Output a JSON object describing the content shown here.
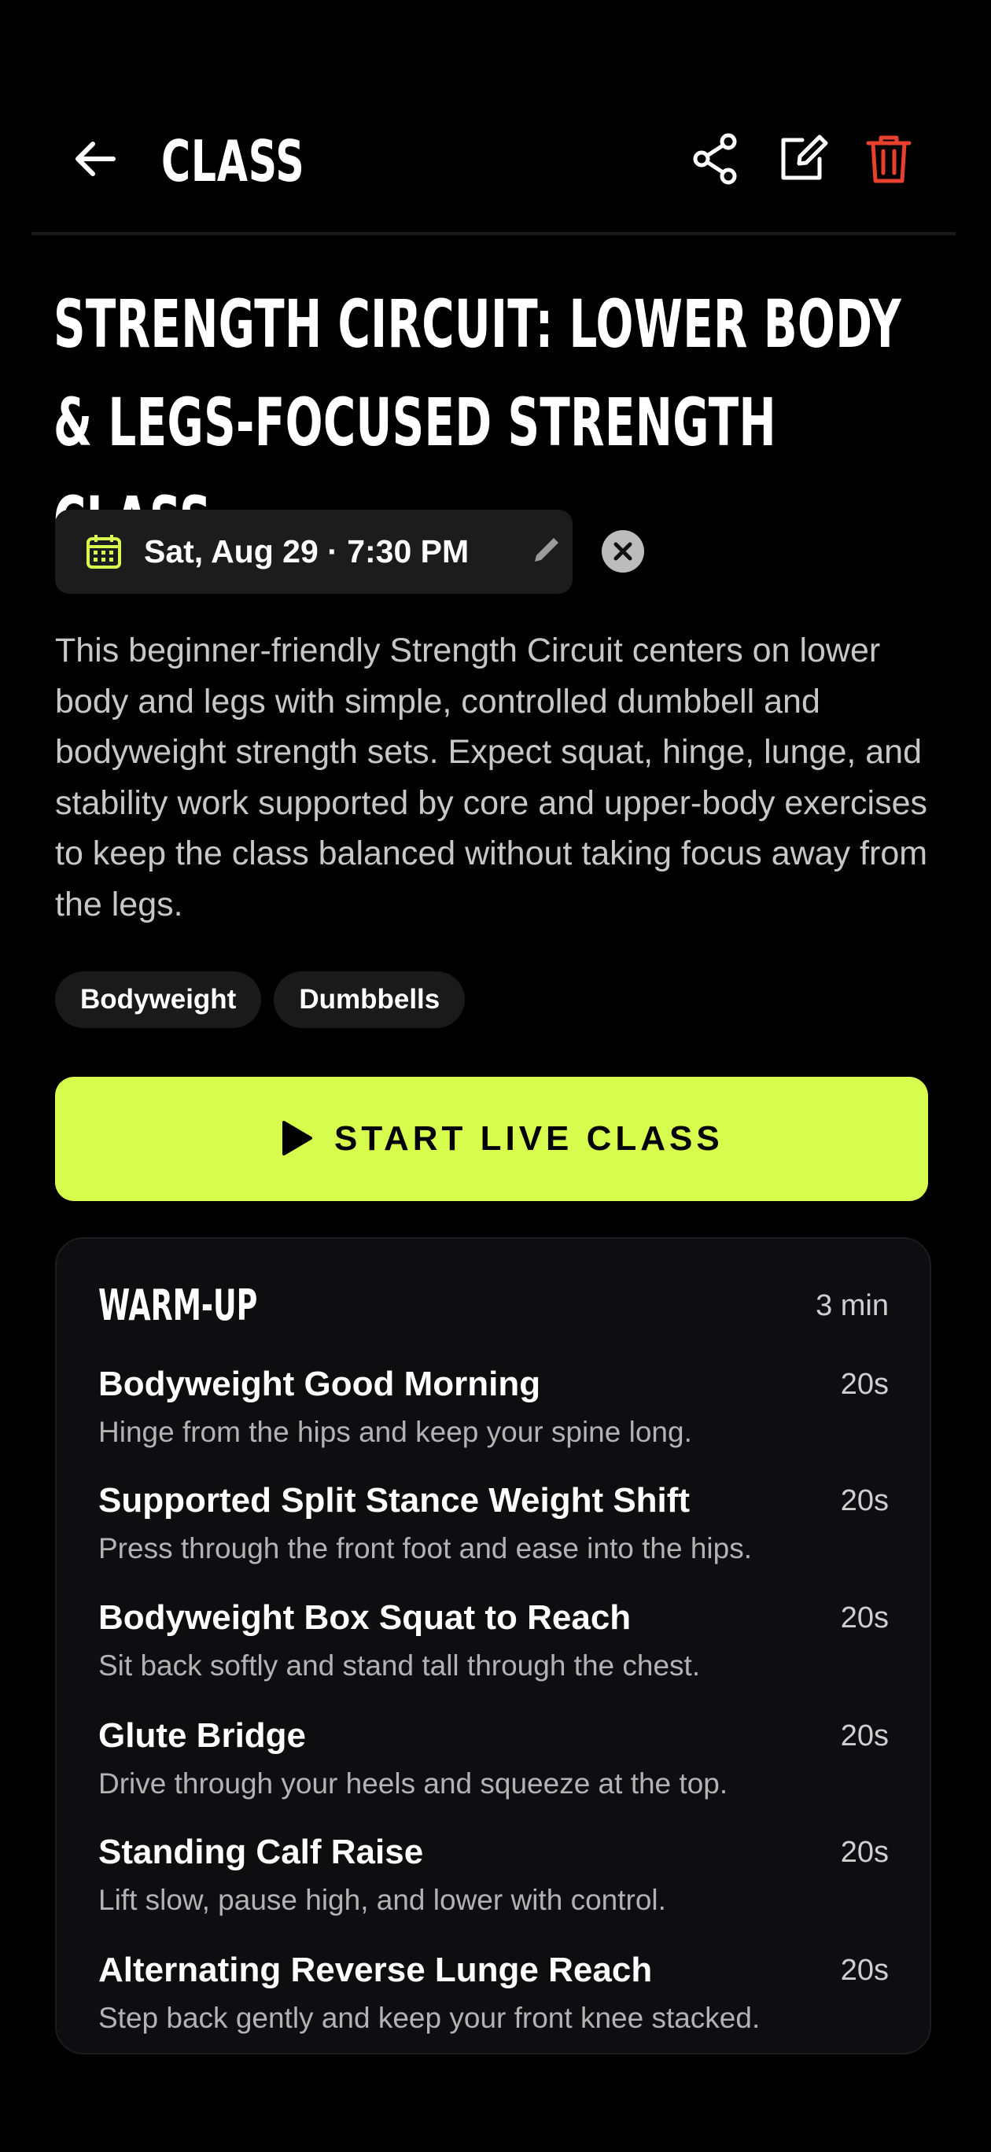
{
  "appbar": {
    "title": "CLASS"
  },
  "class": {
    "title": "STRENGTH CIRCUIT: LOWER BODY & LEGS-FOCUSED STRENGTH CLASS",
    "schedule": "Sat, Aug 29 · 7:30 PM",
    "description": "This beginner-friendly Strength Circuit centers on lower body and legs with simple, controlled dumbbell and bodyweight strength sets. Expect squat, hinge, lunge, and stability work supported by core and upper-body exercises to keep the class balanced without taking focus away from the legs.",
    "tags": [
      "Bodyweight",
      "Dumbbells"
    ]
  },
  "start_button": {
    "label": "START LIVE CLASS"
  },
  "warmup": {
    "title": "WARM-UP",
    "duration": "3 min",
    "exercises": [
      {
        "name": "Bodyweight Good Morning",
        "time": "20s",
        "cue": "Hinge from the hips and keep your spine long."
      },
      {
        "name": "Supported Split Stance Weight Shift",
        "time": "20s",
        "cue": "Press through the front foot and ease into the hips."
      },
      {
        "name": "Bodyweight Box Squat to Reach",
        "time": "20s",
        "cue": "Sit back softly and stand tall through the chest."
      },
      {
        "name": "Glute Bridge",
        "time": "20s",
        "cue": "Drive through your heels and squeeze at the top."
      },
      {
        "name": "Standing Calf Raise",
        "time": "20s",
        "cue": "Lift slow, pause high, and lower with control."
      },
      {
        "name": "Alternating Reverse Lunge Reach",
        "time": "20s",
        "cue": "Step back gently and keep your front knee stacked."
      }
    ]
  },
  "colors": {
    "accent": "#d8fc4e",
    "delete": "#e8402e",
    "background": "#000000",
    "card": "#0e0e10"
  },
  "icons": {
    "back": "arrow-left-icon",
    "share": "share-icon",
    "edit": "edit-icon",
    "delete": "trash-icon",
    "calendar": "calendar-icon",
    "pencil": "pencil-icon",
    "clear": "close-circle-icon",
    "play": "play-icon"
  }
}
